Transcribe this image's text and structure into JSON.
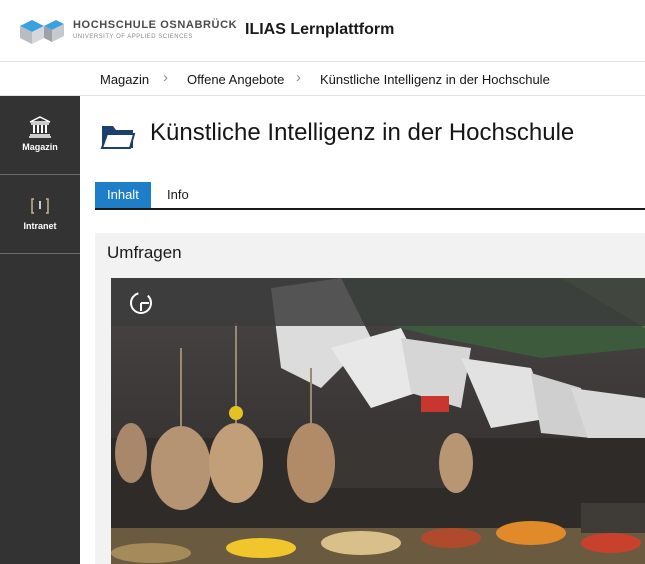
{
  "header": {
    "logo_line1": "HOCHSCHULE OSNABRÜCK",
    "logo_line2": "UNIVERSITY OF APPLIED SCIENCES",
    "app_title": "ILIAS Lernplattform"
  },
  "breadcrumb": [
    "Magazin",
    "Offene Angebote",
    "Künstliche Intelligenz in der Hochschule"
  ],
  "sidebar": {
    "items": [
      {
        "label": "Magazin",
        "icon": "bank-icon"
      },
      {
        "label": "Intranet",
        "icon": "intranet-icon"
      }
    ]
  },
  "main": {
    "title": "Künstliche Intelligenz in der Hochschule",
    "tabs": [
      {
        "label": "Inhalt",
        "active": true
      },
      {
        "label": "Info",
        "active": false
      }
    ],
    "panel_title": "Umfragen"
  },
  "colors": {
    "accent": "#1e7ec8",
    "sidebar_bg": "#333333",
    "logo_blue": "#3aa0e0"
  }
}
